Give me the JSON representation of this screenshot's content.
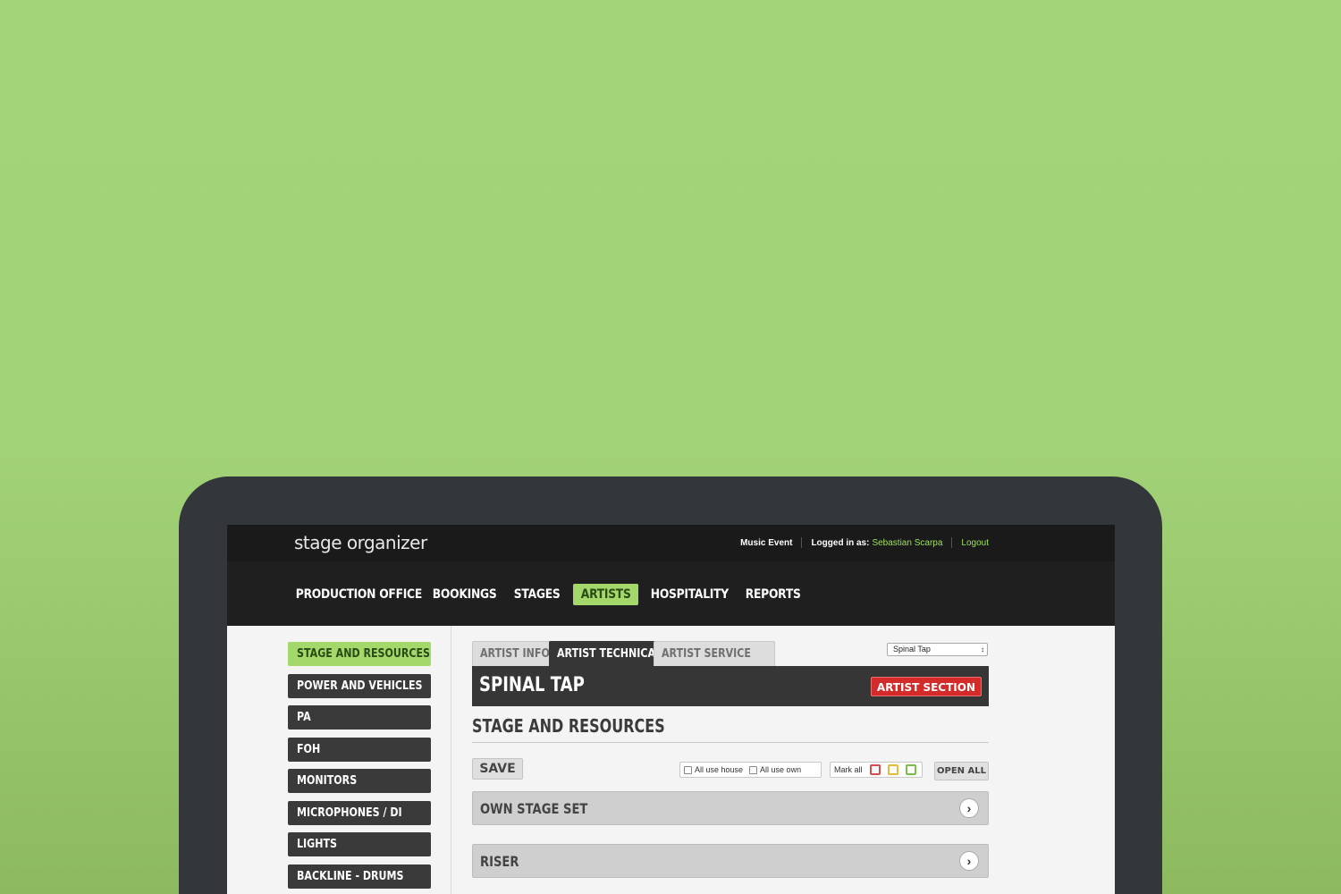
{
  "app": {
    "logo": "stage organizer",
    "event": "Music Event",
    "logged_in_label": "Logged in as:",
    "user": "Sebastian Scarpa",
    "logout": "Logout"
  },
  "nav": {
    "items": [
      "PRODUCTION OFFICE",
      "BOOKINGS",
      "STAGES",
      "ARTISTS",
      "HOSPITALITY",
      "REPORTS"
    ],
    "active": "ARTISTS"
  },
  "sidebar": {
    "items": [
      "STAGE AND RESOURCES",
      "POWER AND VEHICLES",
      "PA",
      "FOH",
      "MONITORS",
      "MICROPHONES / DI",
      "LIGHTS",
      "BACKLINE - DRUMS"
    ],
    "active": "STAGE AND RESOURCES"
  },
  "tabs": {
    "items": [
      "ARTIST INFO",
      "ARTIST TECHNICAL",
      "ARTIST SERVICE"
    ],
    "active": "ARTIST TECHNICAL"
  },
  "artist_select": {
    "value": "Spinal Tap"
  },
  "artist": {
    "name": "SPINAL TAP",
    "section_badge": "ARTIST SECTION"
  },
  "section": {
    "title": "STAGE AND RESOURCES",
    "save": "SAVE",
    "all_use_house": "All use house",
    "all_use_own": "All use own",
    "mark_all": "Mark all",
    "open_all": "OPEN ALL",
    "accordions": [
      "OWN STAGE SET",
      "RISER"
    ]
  },
  "colors": {
    "accent_green": "#a4d86a",
    "link_green": "#9ee05a",
    "badge_red": "#d32a2a",
    "mark_red": "#d94c4c",
    "mark_yellow": "#e6b93a",
    "mark_green": "#78c04a"
  },
  "icons": {
    "chevron": "chevron-right-icon",
    "select_arrows": "up-down-arrows-icon"
  }
}
